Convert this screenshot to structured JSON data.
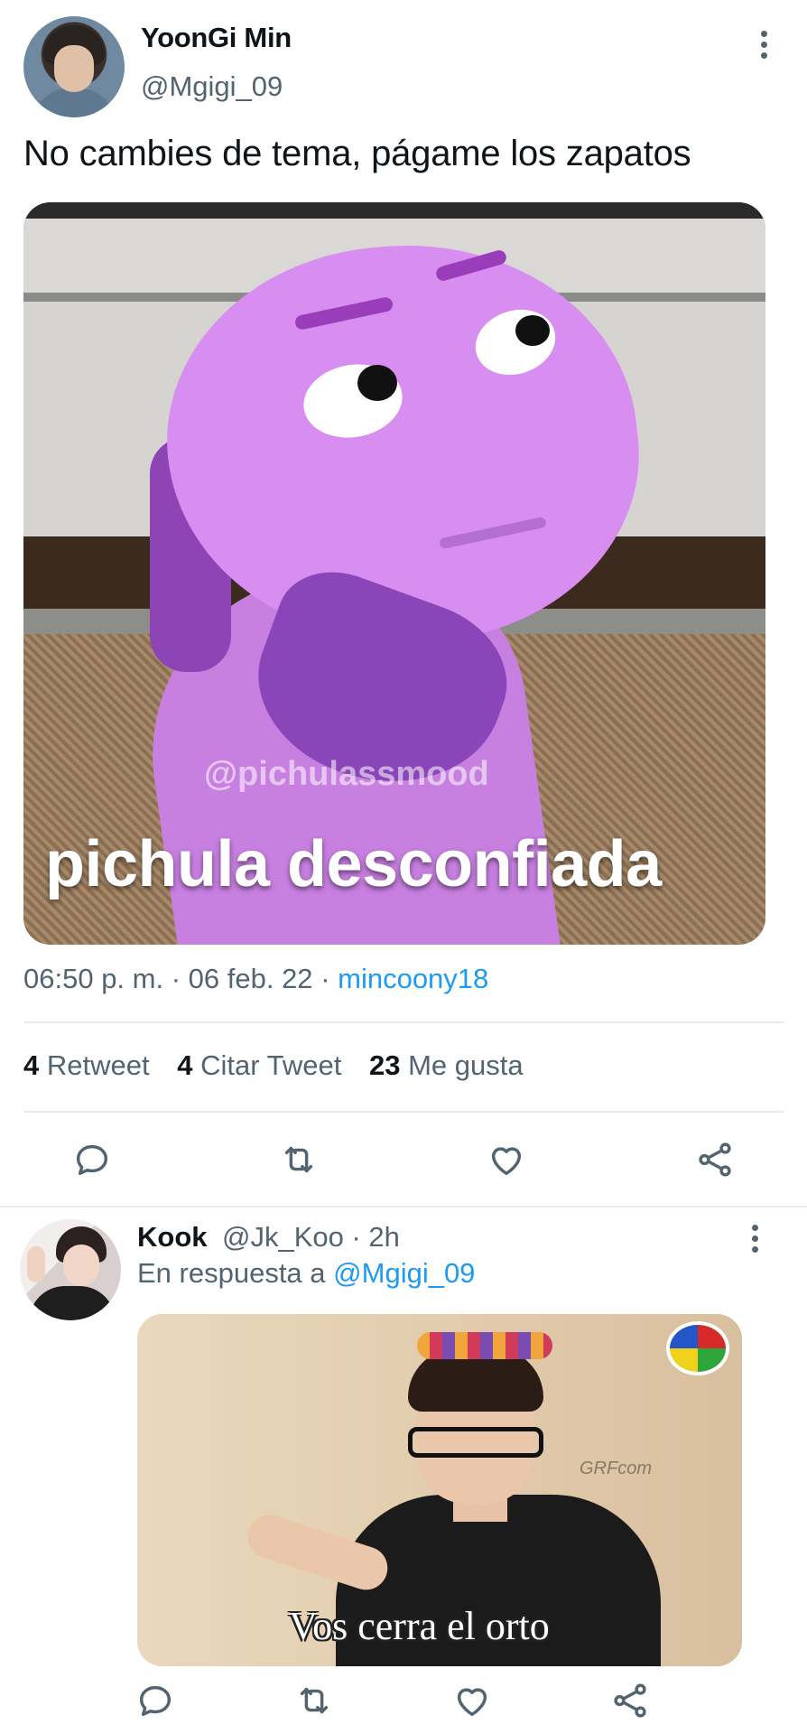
{
  "main_tweet": {
    "display_name": "YoonGi Min",
    "handle": "@Mgigi_09",
    "text": "No cambies de tema, págame los zapatos",
    "media": {
      "watermark": "@pichulassmood",
      "caption": "pichula desconfiada"
    },
    "time": "06:50 p. m.",
    "date": "06 feb. 22",
    "source": "mincoony18",
    "stats": {
      "retweets_count": "4",
      "retweets_label": "Retweet",
      "quotes_count": "4",
      "quotes_label": "Citar Tweet",
      "likes_count": "23",
      "likes_label": "Me gusta"
    }
  },
  "reply": {
    "display_name": "Kook",
    "handle": "@Jk_Koo · 2h",
    "reply_prefix": "En respuesta a",
    "reply_mention": "@Mgigi_09",
    "media": {
      "caption": "Vos cerra el orto",
      "watermark": "GRFcom"
    }
  },
  "icons": {
    "reply": "reply-icon",
    "retweet": "retweet-icon",
    "like": "heart-icon",
    "share": "share-icon",
    "more": "more-vertical-icon"
  },
  "colors": {
    "accent": "#1d9bf0",
    "secondary_text": "#536471",
    "primary_text": "#0f1419",
    "divider": "#e6ecf0"
  }
}
